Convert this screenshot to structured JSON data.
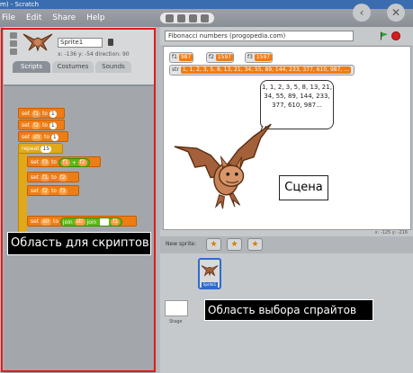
{
  "window": {
    "title": "m) - Scratch"
  },
  "menu": [
    "File",
    "Edit",
    "Share",
    "Help"
  ],
  "sprite": {
    "name": "Sprite1",
    "coords": "x: -136 y: -54 direction: 90"
  },
  "tabs": [
    "Scripts",
    "Costumes",
    "Sounds"
  ],
  "scripts": {
    "set1": {
      "cmd": "set",
      "var": "f1",
      "to": "to",
      "val": "1"
    },
    "set2": {
      "cmd": "set",
      "var": "f2",
      "to": "to",
      "val": "1"
    },
    "set3": {
      "cmd": "set",
      "var": "str",
      "to": "to",
      "val": "1"
    },
    "repeat": {
      "cmd": "repeat",
      "val": "15"
    },
    "set4": {
      "cmd": "set",
      "var": "f3",
      "to": "to",
      "a": "f1",
      "op": "+",
      "b": "f2"
    },
    "set5": {
      "cmd": "set",
      "var": "f1",
      "to": "to",
      "val": "f2"
    },
    "set6": {
      "cmd": "set",
      "var": "f2",
      "to": "to",
      "val": "f3"
    },
    "set7": {
      "cmd": "set",
      "var": "str",
      "to": "to",
      "j1": "join",
      "v1": "str",
      "j2": "join",
      "v2": "f1"
    },
    "say": {
      "cmd": "say",
      "j": "join",
      "v": "str"
    }
  },
  "stage": {
    "title": "Fibonacci numbers (progopedia.com)",
    "monitors": [
      {
        "name": "f1",
        "value": "987"
      },
      {
        "name": "f2",
        "value": "1597"
      },
      {
        "name": "f3",
        "value": "1597"
      }
    ],
    "str_monitor": {
      "name": "str",
      "value": "1, 1, 2, 3, 5, 8, 13, 21, 34, 55, 89, 144, 233, 377, 610, 987, ..."
    },
    "bubble": "1, 1, 2, 3, 5, 8, 13, 21, 34, 55, 89, 144, 233, 377, 610, 987...",
    "mouse": "x: -125   y: -216"
  },
  "new_sprite": {
    "label": "New sprite:"
  },
  "sprites": [
    {
      "name": "Sprite1"
    }
  ],
  "stage_label": "Stage",
  "annotations": {
    "scripts": "Область для скриптов",
    "stage": "Сцена",
    "sprites": "Область выбора спрайтов"
  },
  "colors": {
    "highlight": "#e01b1b",
    "data_block": "#ee7d16",
    "control_block": "#e1a91a",
    "operator_block": "#5cb712",
    "looks_block": "#8a55d7",
    "go_flag": "#27a82b",
    "stop": "#d41f1f"
  }
}
